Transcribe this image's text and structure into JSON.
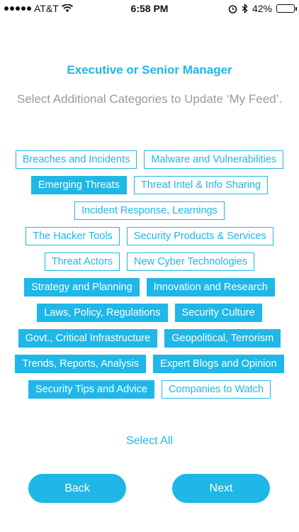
{
  "status_bar": {
    "carrier": "AT&T",
    "time": "6:58 PM",
    "battery": "42%",
    "battery_level": 0.42
  },
  "header": {
    "title": "Executive or Senior Manager",
    "subtitle": "Select Additional Categories to Update ‘My Feed’."
  },
  "categories": [
    {
      "label": "Breaches and Incidents",
      "selected": false
    },
    {
      "label": "Malware and Vulnerabilities",
      "selected": false
    },
    {
      "label": "Emerging Threats",
      "selected": true
    },
    {
      "label": "Threat Intel & Info Sharing",
      "selected": false
    },
    {
      "label": "Incident Response, Learnings",
      "selected": false
    },
    {
      "label": "The Hacker Tools",
      "selected": false
    },
    {
      "label": "Security Products & Services",
      "selected": false
    },
    {
      "label": "Threat Actors",
      "selected": false
    },
    {
      "label": "New Cyber Technologies",
      "selected": false
    },
    {
      "label": "Strategy and Planning",
      "selected": true
    },
    {
      "label": "Innovation and Research",
      "selected": true
    },
    {
      "label": "Laws, Policy, Regulations",
      "selected": true
    },
    {
      "label": "Security Culture",
      "selected": true
    },
    {
      "label": "Govt., Critical Infrastructure",
      "selected": true
    },
    {
      "label": "Geopolitical, Terrorism",
      "selected": true
    },
    {
      "label": "Trends, Reports, Analysis",
      "selected": true
    },
    {
      "label": "Expert Blogs and Opinion",
      "selected": true
    },
    {
      "label": "Security Tips and Advice",
      "selected": true
    },
    {
      "label": "Companies to Watch",
      "selected": false
    }
  ],
  "actions": {
    "select_all": "Select All",
    "back": "Back",
    "next": "Next"
  },
  "colors": {
    "accent": "#1eb7e8",
    "subtitle": "#9a9a9a"
  }
}
